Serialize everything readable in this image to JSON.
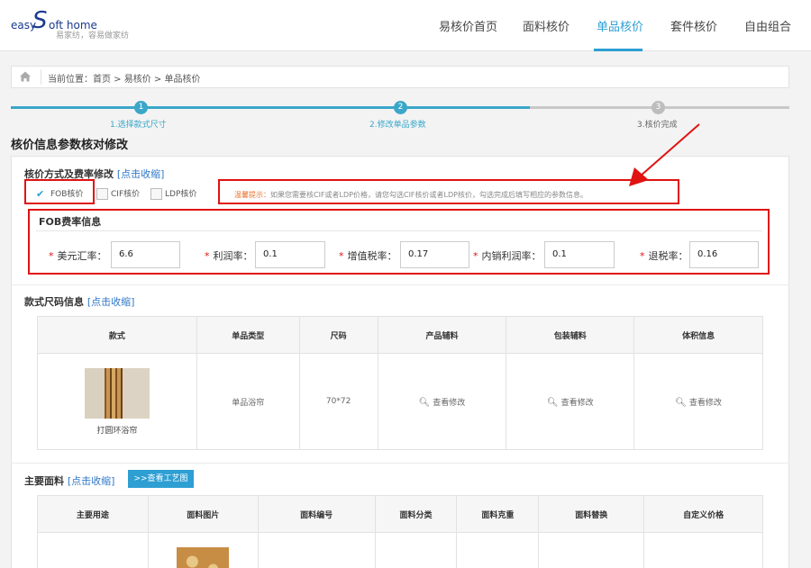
{
  "header": {
    "logo": {
      "easy": "easy",
      "s": "S",
      "rest": "oft home",
      "tagline": "易家纺，容易做家纺"
    },
    "nav": [
      {
        "label": "易核价首页",
        "active": false
      },
      {
        "label": "面料核价",
        "active": false
      },
      {
        "label": "单品核价",
        "active": true
      },
      {
        "label": "套件核价",
        "active": false
      },
      {
        "label": "自由组合",
        "active": false
      }
    ]
  },
  "breadcrumb": {
    "text": "当前位置：首页 > 易核价 > 单品核价"
  },
  "steps": [
    {
      "number": "1",
      "label": "1.选择款式尺寸",
      "state": "done"
    },
    {
      "number": "2",
      "label": "2.修改单品参数",
      "state": "current"
    },
    {
      "number": "3",
      "label": "3.核价完成",
      "state": "pending"
    }
  ],
  "page_title": "核价信息参数核对修改",
  "pricing_method": {
    "title": "核价方式及费率修改",
    "toggle_link": "[点击收缩]",
    "options": [
      {
        "label": "FOB核价",
        "checked": true
      },
      {
        "label": "CIF核价",
        "checked": false
      },
      {
        "label": "LDP核价",
        "checked": false
      }
    ],
    "tip_key": "温馨提示：",
    "tip_text": "如果您需要核CIF或者LDP价格，请您勾选CIF核价或者LDP核价，勾选完成后填写相应的参数信息。"
  },
  "fob": {
    "title": "FOB费率信息",
    "fields": [
      {
        "label": "美元汇率：",
        "value": "6.6"
      },
      {
        "label": "利润率：",
        "value": "0.1"
      },
      {
        "label": "增值税率：",
        "value": "0.17"
      },
      {
        "label": "内销利润率：",
        "value": "0.1"
      },
      {
        "label": "退税率：",
        "value": "0.16"
      }
    ]
  },
  "style_size": {
    "title": "款式尺码信息",
    "toggle_link": "[点击收缩]",
    "columns": [
      "款式",
      "单品类型",
      "尺码",
      "产品辅料",
      "包装辅料",
      "体积信息"
    ],
    "row": {
      "style_name": "打圆环浴帘",
      "type": "单品浴帘",
      "size": "70*72",
      "product_accessory": "查看修改",
      "packaging_accessory": "查看修改",
      "volume": "查看修改"
    }
  },
  "main_fabric": {
    "title": "主要面料",
    "toggle_link": "[点击收缩]",
    "craft_button": ">>查看工艺图",
    "columns": [
      "主要用途",
      "面料图片",
      "面料编号",
      "面料分类",
      "面料克重",
      "面料替换",
      "自定义价格"
    ]
  },
  "colors": {
    "accent": "#2e9fd3",
    "highlight_red": "#e01212",
    "tip_orange": "#e8702a"
  },
  "icons": [
    "home-icon",
    "check-icon",
    "search-icon",
    "arrow-annotation"
  ]
}
